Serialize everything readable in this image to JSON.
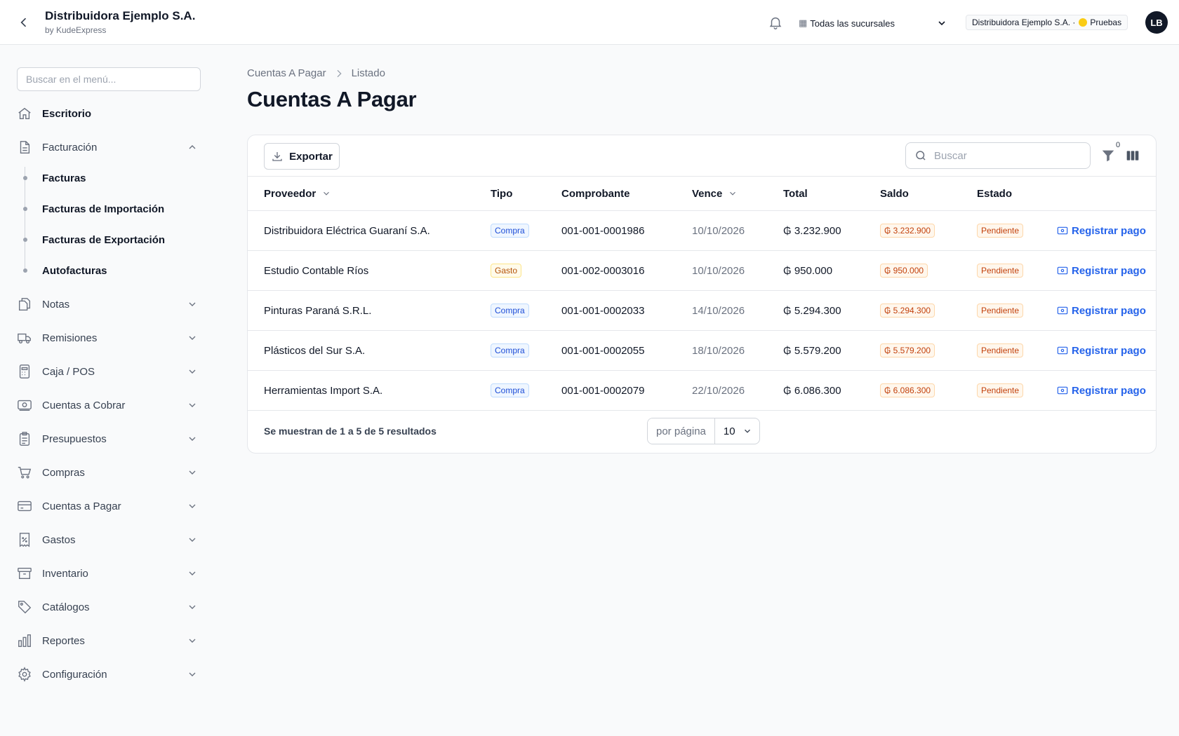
{
  "header": {
    "app_title": "Distribuidora Ejemplo S.A.",
    "app_subtitle": "by KudeExpress",
    "branch_selector": "Todas las sucursales",
    "company_badge": "Distribuidora Ejemplo S.A. ·",
    "environment": "Pruebas",
    "avatar_initials": "LB"
  },
  "sidebar": {
    "search_placeholder": "Buscar en el menú...",
    "items": [
      {
        "label": "Escritorio",
        "icon": "home-icon"
      },
      {
        "label": "Facturación",
        "icon": "document-icon",
        "expanded": true
      },
      {
        "label": "Notas",
        "icon": "notes-icon"
      },
      {
        "label": "Remisiones",
        "icon": "truck-icon"
      },
      {
        "label": "Caja / POS",
        "icon": "calculator-icon"
      },
      {
        "label": "Cuentas a Cobrar",
        "icon": "cash-icon"
      },
      {
        "label": "Presupuestos",
        "icon": "clipboard-icon"
      },
      {
        "label": "Compras",
        "icon": "cart-icon"
      },
      {
        "label": "Cuentas a Pagar",
        "icon": "credit-card-icon"
      },
      {
        "label": "Gastos",
        "icon": "receipt-percent-icon"
      },
      {
        "label": "Inventario",
        "icon": "archive-box-icon"
      },
      {
        "label": "Catálogos",
        "icon": "tag-icon"
      },
      {
        "label": "Reportes",
        "icon": "chart-bar-icon"
      },
      {
        "label": "Configuración",
        "icon": "gear-icon"
      }
    ],
    "facturacion_sub": [
      "Facturas",
      "Facturas de Importación",
      "Facturas de Exportación",
      "Autofacturas"
    ]
  },
  "breadcrumb": {
    "parent": "Cuentas A Pagar",
    "current": "Listado"
  },
  "page_title": "Cuentas A Pagar",
  "toolbar": {
    "export_label": "Exportar",
    "search_placeholder": "Buscar",
    "filter_count": "0"
  },
  "table": {
    "columns": [
      "Proveedor",
      "Tipo",
      "Comprobante",
      "Vence",
      "Total",
      "Saldo",
      "Estado"
    ],
    "rows": [
      {
        "proveedor": "Distribuidora Eléctrica Guaraní S.A.",
        "tipo": "Compra",
        "comprobante": "001-001-0001986",
        "vence": "10/10/2026",
        "total": "₲ 3.232.900",
        "saldo": "₲ 3.232.900",
        "estado": "Pendiente",
        "accion": "Registrar pago"
      },
      {
        "proveedor": "Estudio Contable Ríos",
        "tipo": "Gasto",
        "comprobante": "001-002-0003016",
        "vence": "10/10/2026",
        "total": "₲ 950.000",
        "saldo": "₲ 950.000",
        "estado": "Pendiente",
        "accion": "Registrar pago"
      },
      {
        "proveedor": "Pinturas Paraná S.R.L.",
        "tipo": "Compra",
        "comprobante": "001-001-0002033",
        "vence": "14/10/2026",
        "total": "₲ 5.294.300",
        "saldo": "₲ 5.294.300",
        "estado": "Pendiente",
        "accion": "Registrar pago"
      },
      {
        "proveedor": "Plásticos del Sur S.A.",
        "tipo": "Compra",
        "comprobante": "001-001-0002055",
        "vence": "18/10/2026",
        "total": "₲ 5.579.200",
        "saldo": "₲ 5.579.200",
        "estado": "Pendiente",
        "accion": "Registrar pago"
      },
      {
        "proveedor": "Herramientas Import S.A.",
        "tipo": "Compra",
        "comprobante": "001-001-0002079",
        "vence": "22/10/2026",
        "total": "₲ 6.086.300",
        "saldo": "₲ 6.086.300",
        "estado": "Pendiente",
        "accion": "Registrar pago"
      }
    ]
  },
  "pagination": {
    "summary": "Se muestran de 1 a 5 de 5 resultados",
    "per_page_label": "por página",
    "per_page_value": "10"
  },
  "colors": {
    "link": "#2563eb",
    "pending": "#c2410c",
    "compra_tag": "#1d4ed8",
    "gasto_tag": "#b45309"
  }
}
